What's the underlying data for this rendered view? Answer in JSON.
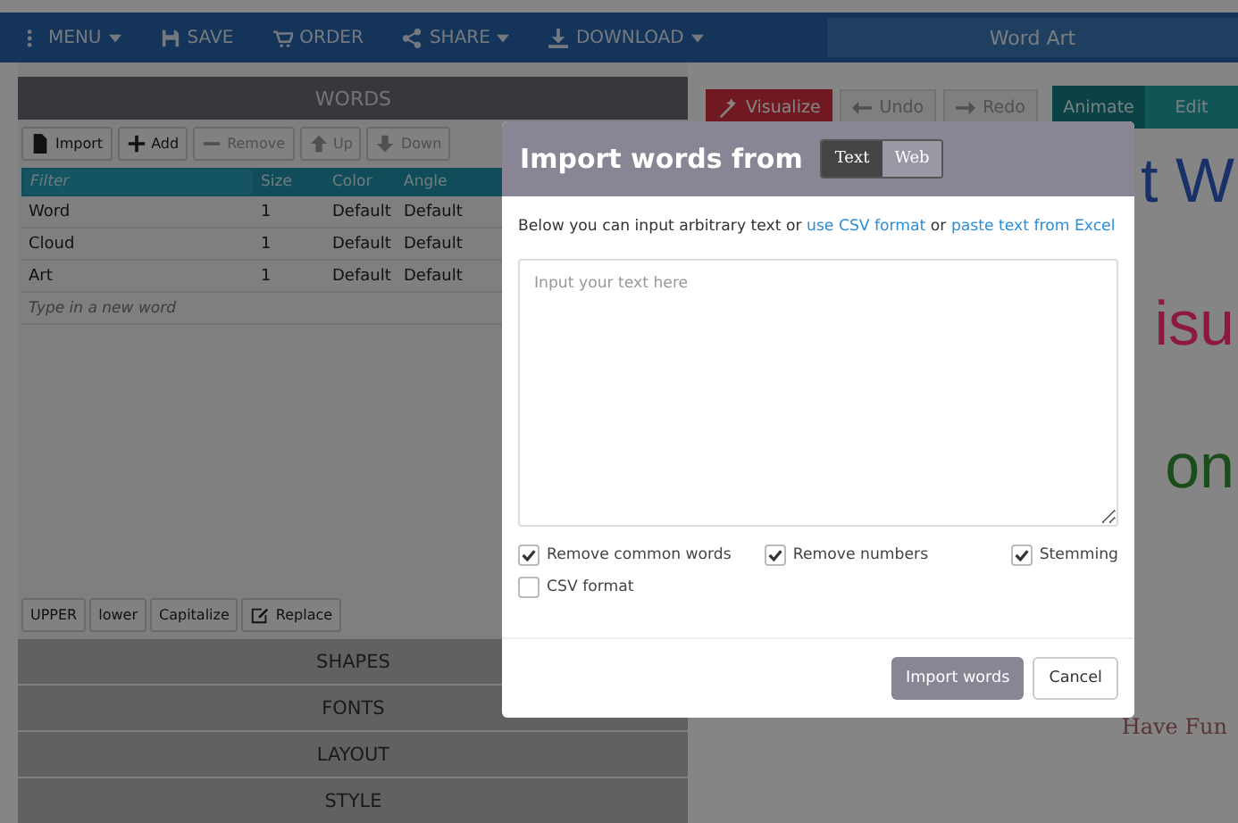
{
  "toolbar": {
    "items": [
      {
        "label": "MENU",
        "dropdown": true
      },
      {
        "label": "SAVE",
        "dropdown": false
      },
      {
        "label": "ORDER",
        "dropdown": false
      },
      {
        "label": "SHARE",
        "dropdown": true
      },
      {
        "label": "DOWNLOAD",
        "dropdown": true
      }
    ],
    "title": "Word Art"
  },
  "words_panel": {
    "title": "WORDS",
    "buttons": [
      {
        "label": "Import",
        "disabled": false
      },
      {
        "label": "Add",
        "disabled": false
      },
      {
        "label": "Remove",
        "disabled": true
      },
      {
        "label": "Up",
        "disabled": true
      },
      {
        "label": "Down",
        "disabled": true
      }
    ],
    "filter_placeholder": "Filter",
    "columns": [
      "Size",
      "Color",
      "Angle"
    ],
    "rows": [
      {
        "word": "Word",
        "size": "1",
        "color_setting": "Default",
        "angle": "Default"
      },
      {
        "word": "Cloud",
        "size": "1",
        "color_setting": "Default",
        "angle": "Default"
      },
      {
        "word": "Art",
        "size": "1",
        "color_setting": "Default",
        "angle": "Default"
      }
    ],
    "new_word_placeholder": "Type in a new word",
    "case_buttons": [
      "UPPER",
      "lower",
      "Capitalize",
      "Replace"
    ],
    "sections": [
      "SHAPES",
      "FONTS",
      "LAYOUT",
      "STYLE"
    ]
  },
  "canvas_toolbar": {
    "visualize": "Visualize",
    "undo": "Undo",
    "redo": "Redo",
    "modes": [
      {
        "label": "Animate",
        "selected": true
      },
      {
        "label": "Edit",
        "selected": false
      }
    ]
  },
  "canvas": {
    "words": [
      {
        "text": "t W",
        "color": "#1a3068",
        "kind": "large"
      },
      {
        "text": "isu",
        "color": "#8c1a3e",
        "kind": "large"
      },
      {
        "text": "on",
        "color": "#1b4d1c",
        "kind": "large"
      },
      {
        "text": "Have Fun",
        "color": "#5a3434",
        "kind": "script"
      }
    ]
  },
  "dialog": {
    "title": "Import words from",
    "sources": [
      {
        "label": "Text",
        "selected": true
      },
      {
        "label": "Web",
        "selected": false
      }
    ],
    "intro": "Below you can input arbitrary text or",
    "link_1": "use CSV format",
    "intro_or": "or",
    "link_2": "paste text from Excel",
    "placeholder": "Input your text here",
    "options": [
      {
        "label": "Remove common words",
        "checked": true
      },
      {
        "label": "Remove numbers",
        "checked": true
      },
      {
        "label": "Stemming",
        "checked": true
      },
      {
        "label": "CSV format",
        "checked": false
      }
    ],
    "primary_button": "Import words",
    "cancel_button": "Cancel"
  }
}
